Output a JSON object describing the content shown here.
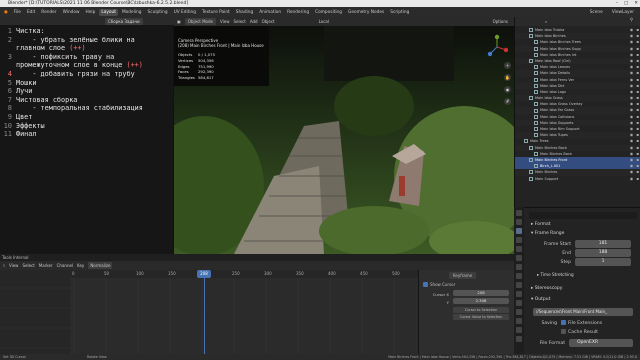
{
  "window": {
    "title": "Blender* [D:\\TUTORIALS\\2021 11 06 Blender Course\\BC\\Izbushka-6.2.5.2.blend]"
  },
  "menu": {
    "items": [
      "File",
      "Edit",
      "Render",
      "Window",
      "Help"
    ],
    "workspaces": [
      "Layout",
      "Modeling",
      "Sculpting",
      "UV Editing",
      "Texture Paint",
      "Shading",
      "Animation",
      "Rendering",
      "Compositing",
      "Geometry Nodes",
      "Scripting"
    ],
    "active_workspace": "Layout",
    "scene": "Scene",
    "view_layer": "ViewLayer"
  },
  "text_editor": {
    "lines": [
      {
        "num": "1",
        "text": "Чистка:",
        "color": "#e6e6e6"
      },
      {
        "num": "2",
        "text": "    - убрать зелёные блики на",
        "color": "#e6e6e6"
      },
      {
        "num": "",
        "text": "главном слое (++)",
        "color": "#e6e6e6",
        "red_tail": "(++)"
      },
      {
        "num": "3",
        "text": "    - пофиксить траву на",
        "color": "#e6e6e6"
      },
      {
        "num": "",
        "text": "промежуточном слое в конце (++)",
        "color": "#e6e6e6"
      },
      {
        "num": "4",
        "text": "    - добавить грязи на трубу",
        "color": "#e6e6e6",
        "hl": true
      },
      {
        "num": "5",
        "text": "Мошки",
        "color": "#e6e6e6"
      },
      {
        "num": "6",
        "text": "Лучи",
        "color": "#e6e6e6"
      },
      {
        "num": "7",
        "text": "Чистовая сборка",
        "color": "#e6e6e6"
      },
      {
        "num": "8",
        "text": "    - темпоральная стабилизация",
        "color": "#e6e6e6"
      },
      {
        "num": "9",
        "text": "Цвет",
        "color": "#e6e6e6"
      },
      {
        "num": "10",
        "text": "Эффекты",
        "color": "#e6e6e6"
      },
      {
        "num": "11",
        "text": "Финал",
        "color": "#e6e6e6"
      }
    ],
    "header": "Сборка Задачи"
  },
  "viewport": {
    "header": {
      "mode": "Object Mode",
      "menus": [
        "View",
        "Select",
        "Add",
        "Object"
      ],
      "transform": "Local",
      "options": "Options"
    },
    "info": [
      "Camera Perspective",
      "(208) Main Birches Front | Main Izba House"
    ],
    "stats": [
      {
        "k": "Objects",
        "v": "0 / 1,075"
      },
      {
        "k": "Vertices",
        "v": "504,356"
      },
      {
        "k": "Edges",
        "v": "751,990"
      },
      {
        "k": "Faces",
        "v": "292,390"
      },
      {
        "k": "Triangles",
        "v": "584,817"
      }
    ]
  },
  "outliner": {
    "rows": [
      {
        "text": "Main Izba Trubka",
        "indent": 2
      },
      {
        "text": "Main Izba Birches",
        "indent": 2
      },
      {
        "text": "Main Izba Birches Trees",
        "indent": 3
      },
      {
        "text": "Main Izba Birches Supp",
        "indent": 3
      },
      {
        "text": "Main Izba Birches Int",
        "indent": 3
      },
      {
        "text": "Main Izba Roof (Ctrl)",
        "indent": 2
      },
      {
        "text": "Main Izba Leaves",
        "indent": 3
      },
      {
        "text": "Main Izba Details",
        "indent": 3
      },
      {
        "text": "Main Izba Ferns Ver",
        "indent": 3
      },
      {
        "text": "Main Izba Dirt",
        "indent": 3
      },
      {
        "text": "Main Izba Logs",
        "indent": 3
      },
      {
        "text": "Main Izba Grass",
        "indent": 2
      },
      {
        "text": "Main Izba Grass Overlay",
        "indent": 3
      },
      {
        "text": "Main Izba Far Grass",
        "indent": 3
      },
      {
        "text": "Main Izba Collisions",
        "indent": 3
      },
      {
        "text": "Main Izba Supports",
        "indent": 3
      },
      {
        "text": "Main Izba Rim Support",
        "indent": 3
      },
      {
        "text": "Main Izba Tupes",
        "indent": 3
      },
      {
        "text": "Main Trees",
        "indent": 1
      },
      {
        "text": "Main Birches Back",
        "indent": 2
      },
      {
        "text": "Main Birches Back",
        "indent": 3
      },
      {
        "text": "Main Birches Front",
        "indent": 2,
        "sel": true
      },
      {
        "text": "Birch_L.001",
        "indent": 3,
        "sel2": true
      },
      {
        "text": "Main Birches",
        "indent": 2
      },
      {
        "text": "Main Support",
        "indent": 2
      }
    ]
  },
  "properties": {
    "format": "Format",
    "frame_range": "Frame Range",
    "frame_start_label": "Frame Start",
    "frame_start": "181",
    "end_label": "End",
    "end": "188",
    "step_label": "Step",
    "step": "1",
    "time_stretching": "Time Stretching",
    "stereoscopy": "Stereoscopy",
    "output": "Output",
    "output_path": "//Sequences\\Front Main\\Front Main_",
    "saving_label": "Saving",
    "file_extensions": "File Extensions",
    "cache_result": "Cache Result",
    "file_format_label": "File Format",
    "file_format": "OpenEXR"
  },
  "timeline": {
    "status": "Tools Internal",
    "header": [
      "View",
      "Select",
      "Marker",
      "Channel",
      "Key",
      "Normalize"
    ],
    "ruler": [
      "0",
      "50",
      "100",
      "150",
      "200",
      "250",
      "300",
      "350",
      "400",
      "450",
      "500",
      "550",
      "600",
      "650"
    ],
    "current_frame": "208",
    "panel": {
      "title": "Keyframe",
      "show_cursor": "Show Cursor",
      "cursor_x_label": "Cursor X",
      "cursor_x": "208",
      "cursor_y_label": "Y",
      "cursor_y": "2.308",
      "btn1": "Cursor to Selection",
      "btn2": "Cursor Value to Selection"
    }
  },
  "statusbar": {
    "left": "Set 3D Cursor",
    "middle": "Rotate View",
    "right": "Main Birches Front | Main Izba House | Verts:504,356 | Faces:292,390 | Tris:584,817 | Objects:0/1,075 | Memory: 7.51 GiB | VRAM: 4.2/11.0 GiB | 2.93.0"
  }
}
